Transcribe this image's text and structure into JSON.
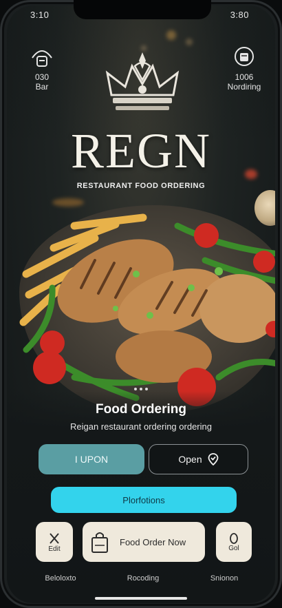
{
  "status_bar": {
    "time": "3:10",
    "right": "3:80"
  },
  "corner_left": {
    "line1": "030",
    "line2": "Bar"
  },
  "corner_right": {
    "line1": "1006",
    "line2": "Nordiring"
  },
  "brand": {
    "name": "REGN",
    "tagline": "RESTAURANT FOOD ORDERING"
  },
  "main": {
    "title": "Food Ordering",
    "subtitle": "Reigan restaurant ordering ordering"
  },
  "buttons": {
    "upon_label": "I UPON",
    "open_label": "Open",
    "primary_label": "Plorfotions"
  },
  "tiles": {
    "left_label": "Edit",
    "center_label": "Food Order Now",
    "right_label": "Gol"
  },
  "tabs": [
    "Beloloxto",
    "Rocoding",
    "Snionon"
  ],
  "colors": {
    "accent": "#33d3ec",
    "teal_button": "#5a9ea3",
    "tile": "#efe9dc"
  }
}
